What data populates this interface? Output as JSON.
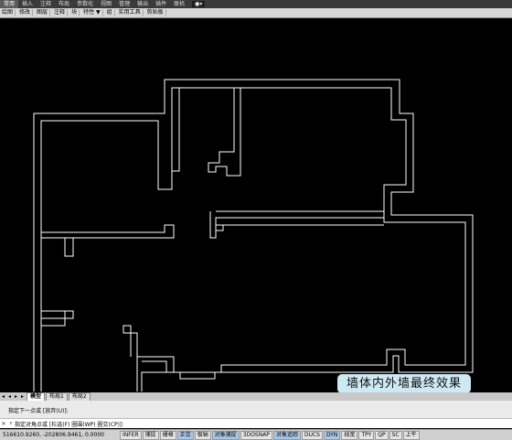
{
  "menu": {
    "tabs": [
      "常用",
      "插入",
      "注释",
      "布局",
      "参数化",
      "视图",
      "管理",
      "输出",
      "插件",
      "联机"
    ],
    "active_index": 0
  },
  "ribbon": {
    "panels": [
      "绘图",
      "修改",
      "图层",
      "注释",
      "块",
      "特性 ▼",
      "组",
      "实用工具",
      "剪贴板"
    ]
  },
  "caption": "墙体内外墙最终效果",
  "layout_tabs": [
    "模型",
    "布局1",
    "布局2"
  ],
  "command": {
    "history": "指定下一点或 [放弃(U)]:",
    "prompt": "指定对角点或 [栏选(F) 圈围(WP) 圈交(CP)]:"
  },
  "status": {
    "coordinates": "516610.9260, -202806.9461, 0.0000",
    "toggles": [
      "INFER",
      "捕捉",
      "栅格",
      "正交",
      "极轴",
      "对象捕捉",
      "3DOSNAP",
      "对象追踪",
      "DUCS",
      "DYN",
      "线宽",
      "TPY",
      "QP",
      "SC",
      "上午"
    ],
    "on": [
      "正交",
      "对象捕捉",
      "对象追踪",
      "DYN"
    ]
  },
  "colors": {
    "drawing_background": "#000000",
    "wall_lines": "#ffffff",
    "caption_bg": "#cde9f2"
  }
}
